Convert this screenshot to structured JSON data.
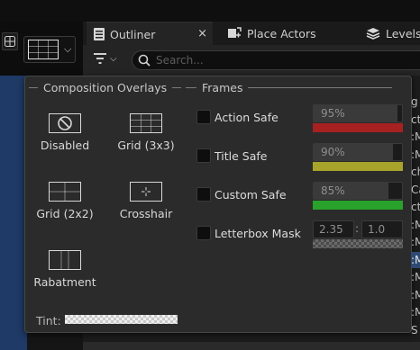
{
  "tabs": {
    "outliner": "Outliner",
    "outliner_close": "×",
    "place_actors": "Place Actors",
    "levels": "Levels"
  },
  "search": {
    "placeholder": "Search..."
  },
  "outliner_peek": [
    {
      "text": "g",
      "selected": false
    },
    {
      "text": "ct",
      "selected": false
    },
    {
      "text": ":M",
      "selected": false
    },
    {
      "text": ":M",
      "selected": false
    },
    {
      "text": "che",
      "selected": false
    },
    {
      "text": "Ca",
      "selected": false
    },
    {
      "text": "cti",
      "selected": false
    },
    {
      "text": ":M",
      "selected": false
    },
    {
      "text": ":M",
      "selected": false
    },
    {
      "text": ":M",
      "selected": true
    },
    {
      "text": ":M",
      "selected": false
    },
    {
      "text": ":M",
      "selected": false
    },
    {
      "text": ":M",
      "selected": false
    },
    {
      "text": "S",
      "selected": false
    }
  ],
  "popup": {
    "composition_header": "Composition Overlays",
    "frames_header": "Frames",
    "overlays": {
      "disabled": "Disabled",
      "grid3": "Grid (3x3)",
      "grid2": "Grid (2x2)",
      "crosshair": "Crosshair",
      "rabatment": "Rabatment"
    },
    "frames": {
      "action_safe": {
        "label": "Action Safe",
        "value": "95%",
        "fraction": 0.95,
        "color": "#a72121"
      },
      "title_safe": {
        "label": "Title Safe",
        "value": "90%",
        "fraction": 0.9,
        "color": "#a8a32a"
      },
      "custom_safe": {
        "label": "Custom Safe",
        "value": "85%",
        "fraction": 0.85,
        "color": "#28a22a"
      },
      "letterbox": {
        "label": "Letterbox Mask",
        "width": "2.35",
        "height": "1.0",
        "separator": ":"
      }
    },
    "tint_label": "Tint:"
  }
}
